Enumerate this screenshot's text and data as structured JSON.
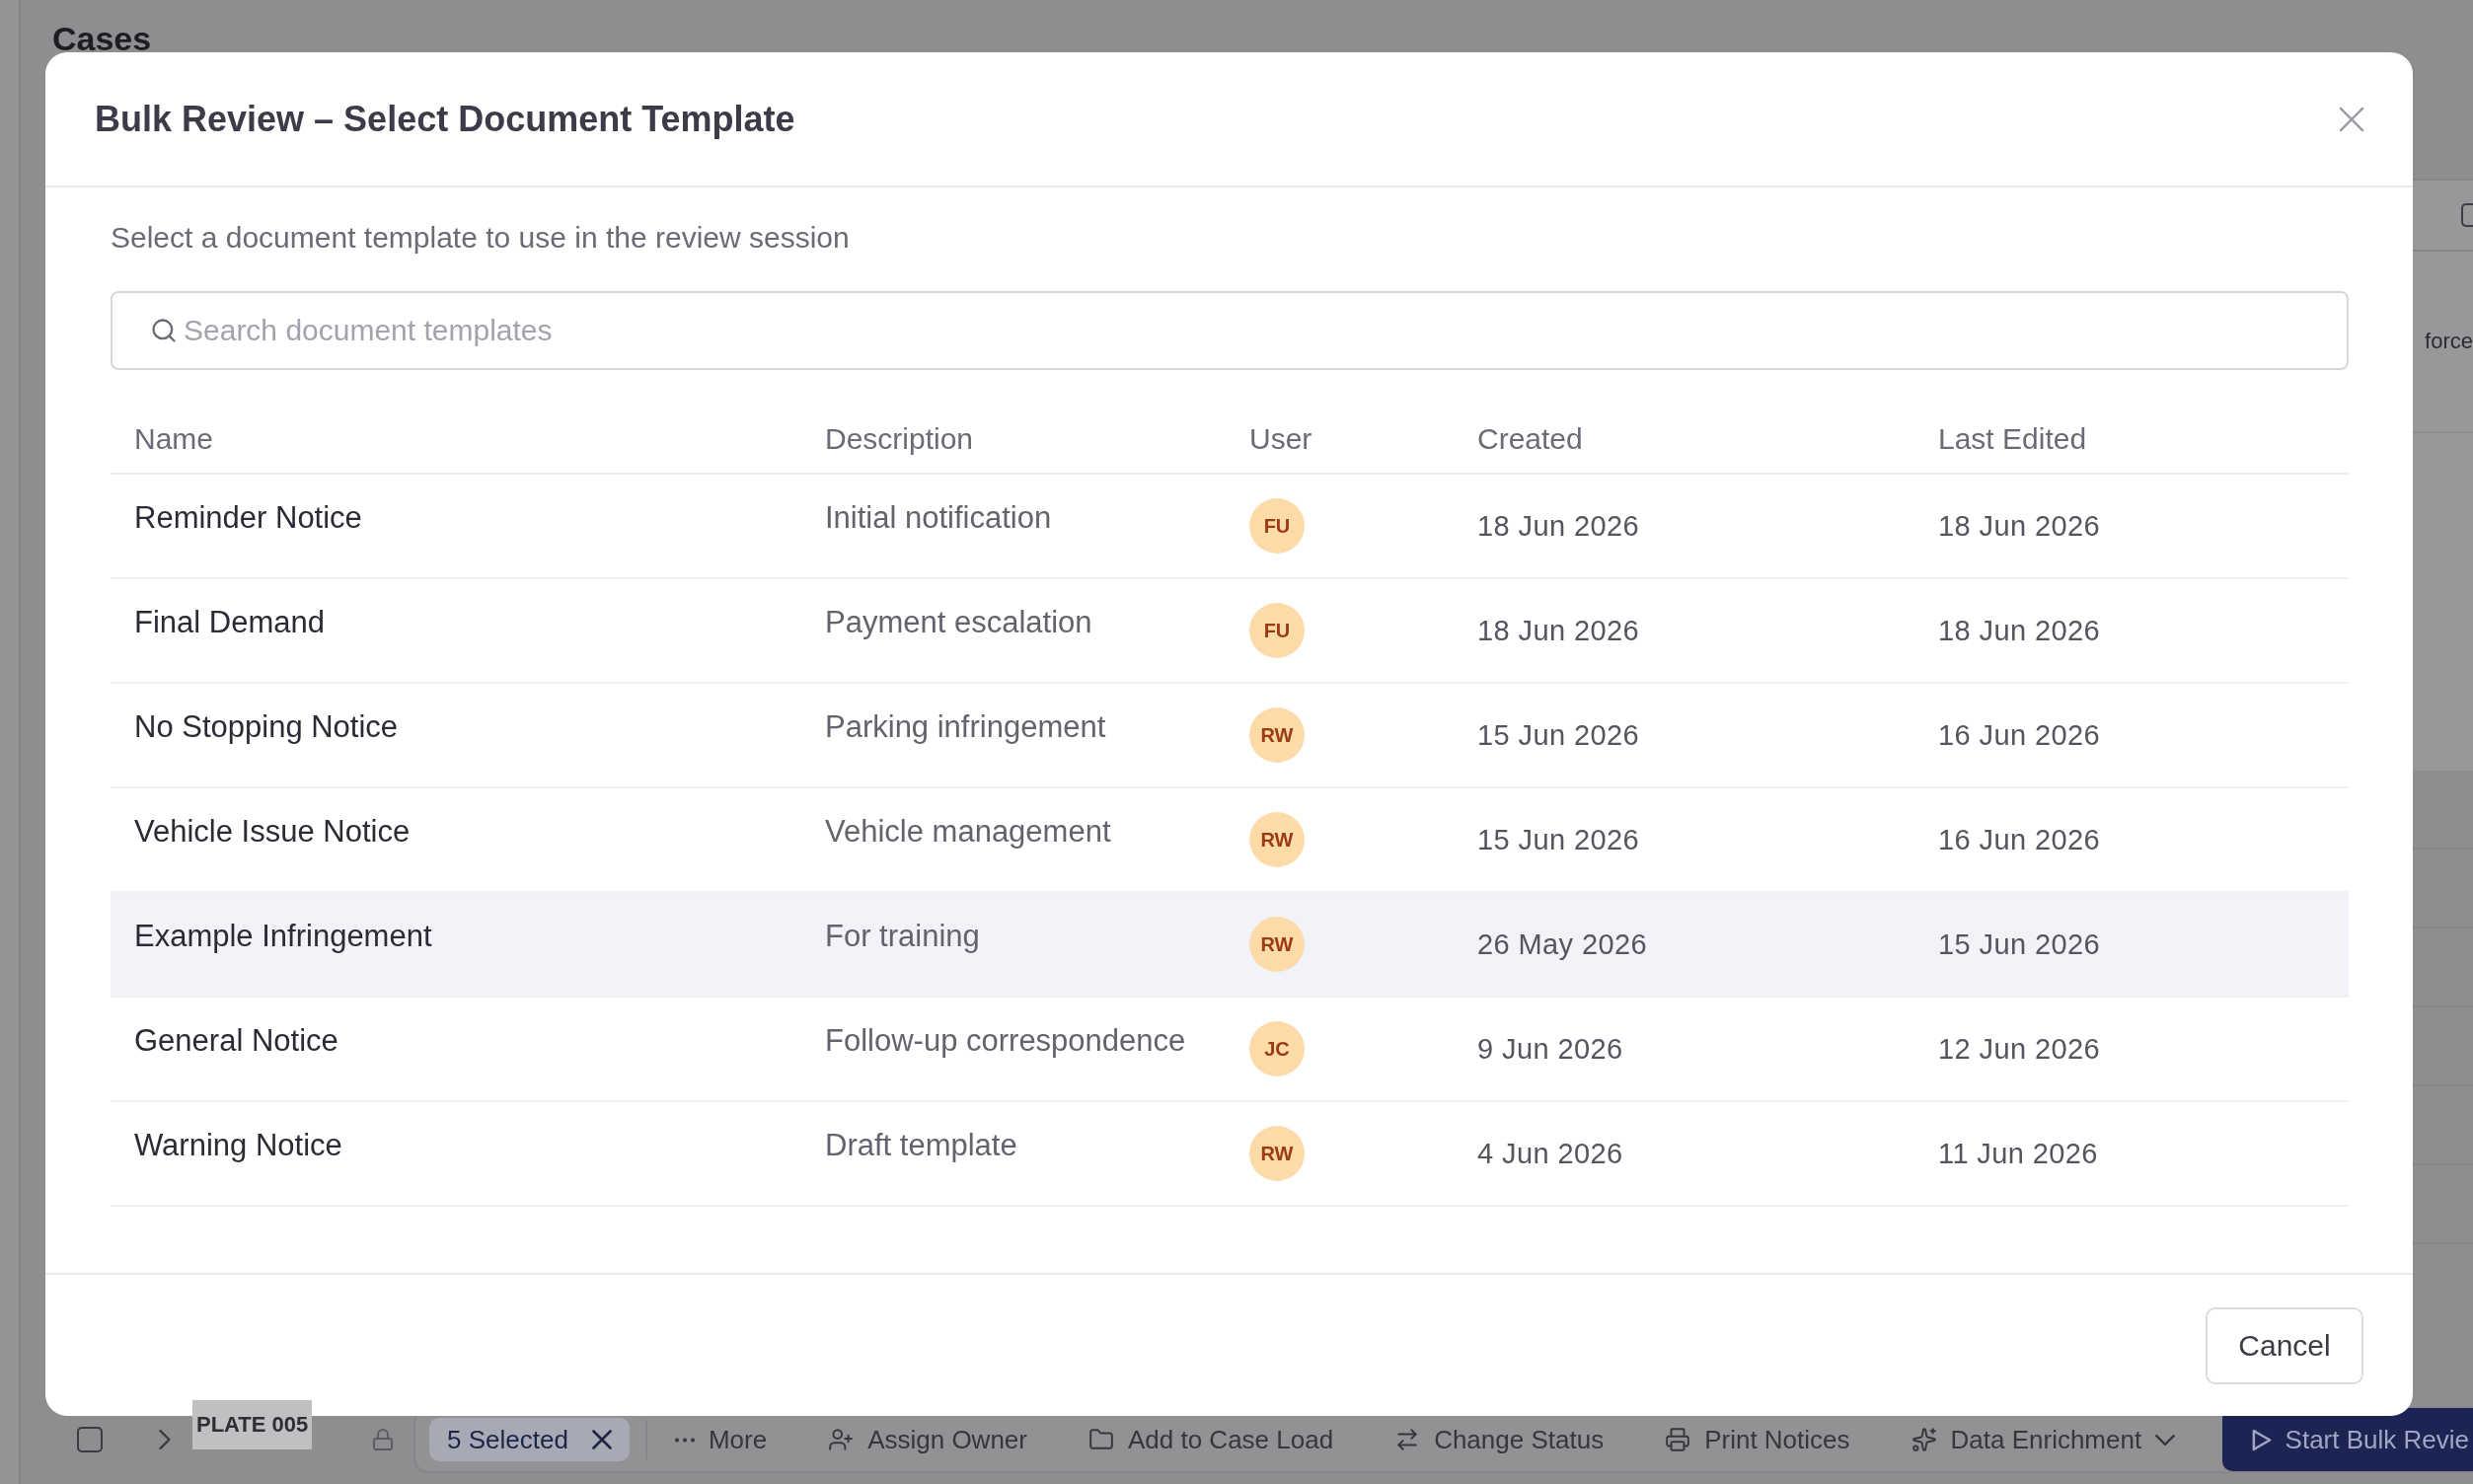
{
  "background": {
    "heading": "Cases",
    "side_text": "force",
    "plate_label": "PLATE 005"
  },
  "bulk_bar": {
    "select_all": {
      "checked": false
    },
    "selection": "5 Selected",
    "actions": [
      {
        "kind": "more",
        "label": "More",
        "dropdown": false
      },
      {
        "kind": "assign",
        "label": "Assign Owner",
        "dropdown": false
      },
      {
        "kind": "case-load",
        "label": "Add to Case Load",
        "dropdown": false
      },
      {
        "kind": "status",
        "label": "Change Status",
        "dropdown": false
      },
      {
        "kind": "print",
        "label": "Print Notices",
        "dropdown": false
      },
      {
        "kind": "enrich",
        "label": "Data Enrichment",
        "dropdown": true
      }
    ],
    "primary": "Start Bulk Revie"
  },
  "dialog": {
    "title": "Bulk Review – Select Document Template",
    "subtitle": "Select a document template to use in the review session",
    "search": {
      "placeholder": "Search document templates"
    },
    "table": {
      "columns": [
        "Name",
        "Description",
        "User",
        "Created",
        "Last Edited"
      ],
      "rows": [
        {
          "name": "Reminder Notice",
          "description": "Initial notification",
          "user": "FU",
          "created": "18 Jun 2026",
          "last_edited": "18 Jun 2026",
          "hovered": false
        },
        {
          "name": "Final Demand",
          "description": "Payment escalation",
          "user": "FU",
          "created": "18 Jun 2026",
          "last_edited": "18 Jun 2026",
          "hovered": false
        },
        {
          "name": "No Stopping Notice",
          "description": "Parking infringement",
          "user": "RW",
          "created": "15 Jun 2026",
          "last_edited": "16 Jun 2026",
          "hovered": false
        },
        {
          "name": "Vehicle Issue Notice",
          "description": "Vehicle management",
          "user": "RW",
          "created": "15 Jun 2026",
          "last_edited": "16 Jun 2026",
          "hovered": false
        },
        {
          "name": "Example Infringement",
          "description": "For training",
          "user": "RW",
          "created": "26 May 2026",
          "last_edited": "15 Jun 2026",
          "hovered": true
        },
        {
          "name": "General Notice",
          "description": "Follow-up correspondence",
          "user": "JC",
          "created": "9 Jun 2026",
          "last_edited": "12 Jun 2026",
          "hovered": false
        },
        {
          "name": "Warning Notice",
          "description": "Draft template",
          "user": "RW",
          "created": "4 Jun 2026",
          "last_edited": "11 Jun 2026",
          "hovered": false
        }
      ]
    },
    "buttons": [
      "Cancel"
    ]
  }
}
